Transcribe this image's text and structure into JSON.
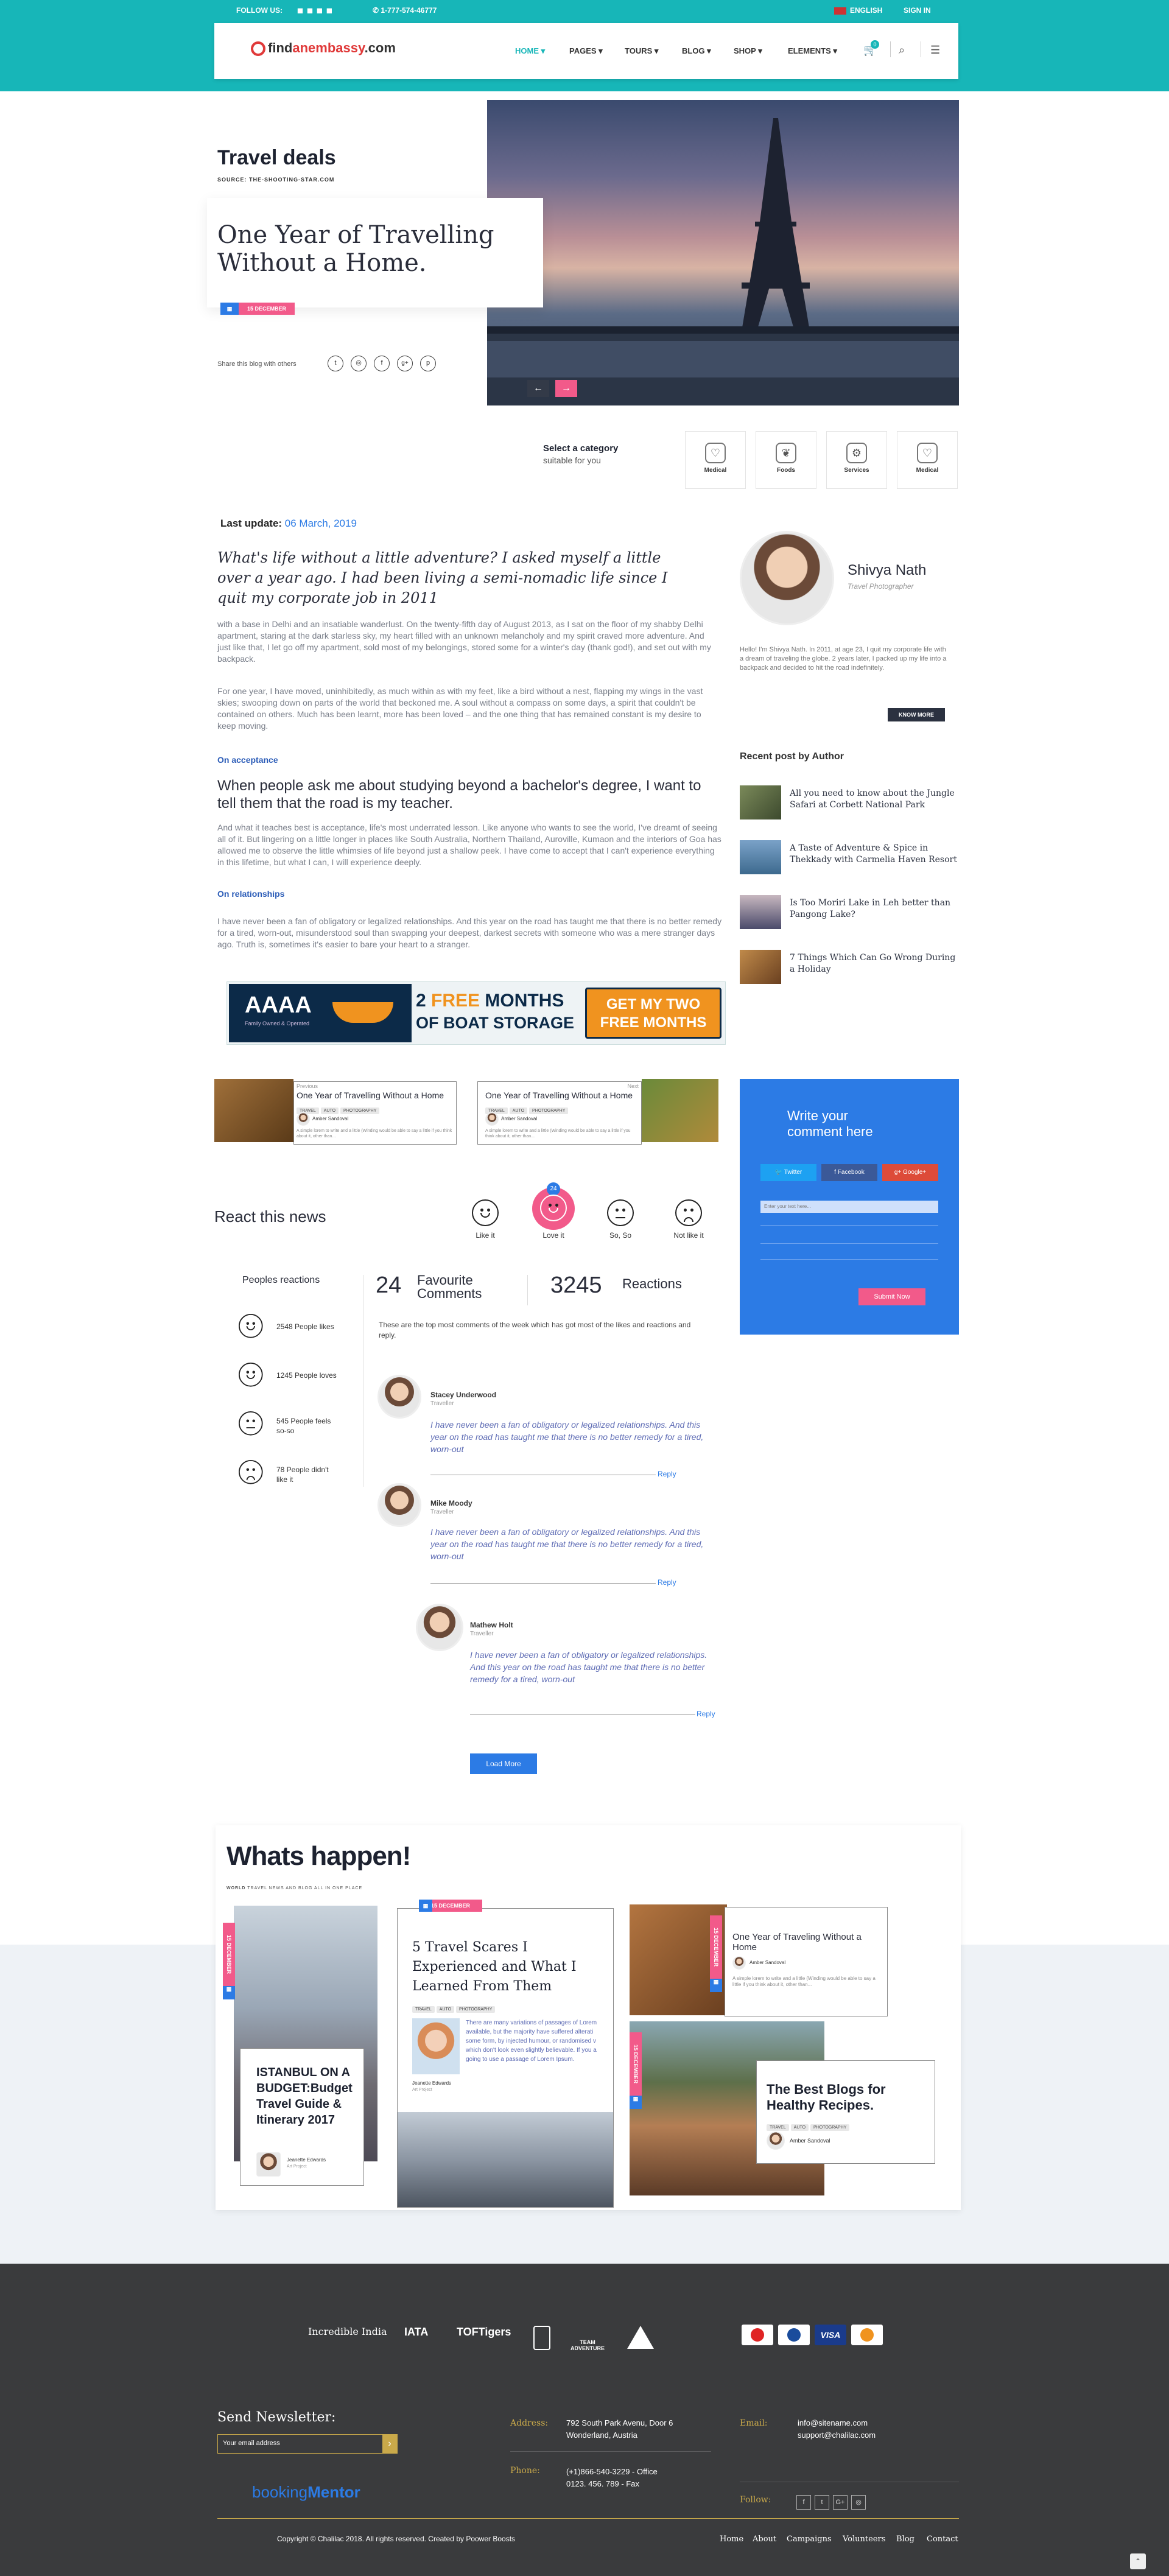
{
  "topbar": {
    "follow_us": "FOLLOW US:",
    "phone": "1-777-574-46777",
    "language": "ENGLISH",
    "sign_in": "SIGN IN"
  },
  "header": {
    "logo_pre": "find",
    "logo_em": "an",
    "logo_mid": "embassy",
    "logo_post": ".com",
    "nav": [
      "HOME",
      "PAGES",
      "TOURS",
      "BLOG",
      "SHOP",
      "ELEMENTS"
    ],
    "cart_count": "0"
  },
  "hero": {
    "category": "Travel deals",
    "source": "SOURCE: THE-SHOOTING-STAR.COM",
    "title_line1": "One Year of Travelling",
    "title_line2": "Without a Home.",
    "date_badge": "15 DECEMBER",
    "share_label": "Share this blog with others"
  },
  "categories": {
    "title": "Select a category",
    "subtitle": "suitable for you",
    "items": [
      "Medical",
      "Foods",
      "Services",
      "Medical"
    ]
  },
  "article": {
    "last_update_label": "Last update:",
    "last_update_value": "06 March, 2019",
    "lead": "What's life without a little adventure? I asked myself a little over a year ago. I had been living a semi-nomadic life since I quit my corporate job in 2011",
    "p1": "with a base in Delhi and an insatiable wanderlust. On the twenty-fifth day of August 2013, as I sat on the floor of my shabby Delhi apartment, staring at the dark starless sky, my heart filled with an unknown melancholy and my spirit craved more adventure. And just like that, I let go off my apartment, sold most of my belongings, stored some for a winter's day (thank god!), and set out with my backpack.",
    "p2": "For one year, I have moved, uninhibitedly, as much within as with my feet, like a bird without a nest, flapping my wings in the vast skies; swooping down on parts of the world that beckoned me. A soul without a compass on some days, a spirit that couldn't be contained on others. Much has been learnt, more has been loved – and the one thing that has remained constant is my desire to keep moving.",
    "h_acceptance": "On acceptance",
    "quote": "When people ask me about studying beyond a bachelor's degree, I want to tell them that the road is my teacher.",
    "p3": "And what it teaches best is acceptance, life's most underrated lesson. Like anyone who wants to see the world, I've dreamt of seeing all of it. But lingering on a little longer in places like South Australia, Northern Thailand, Auroville, Kumaon and the interiors of Goa has allowed me to observe the little whimsies of life beyond just a shallow peek. I have come to accept that I can't experience everything in this lifetime, but what I can, I will experience deeply.",
    "h_relationships": "On relationships",
    "p4": "I have never been a fan of obligatory or legalized relationships. And this year on the road has taught me that there is no better remedy for a tired, worn-out, misunderstood soul than swapping your deepest, darkest secrets with someone who was a mere stranger days ago. Truth is, sometimes it's easier to bare your heart to a stranger."
  },
  "ad": {
    "brand": "AAAA",
    "brand_sub": "Family Owned & Operated",
    "line1_pre": "2 ",
    "line1_em": "FREE",
    "line1_post": " MONTHS",
    "line2": "OF BOAT STORAGE",
    "cta": "GET MY TWO FREE MONTHS"
  },
  "author": {
    "name": "Shivya Nath",
    "role": "Travel Photographer",
    "bio": "Hello! I'm Shivya Nath. In 2011, at age 23, I quit my corporate life with a dream of traveling the globe. 2 years later, I packed up my life into a backpack and decided to hit the road indefinitely.",
    "know_more": "KNOW MORE"
  },
  "recent": {
    "title": "Recent post by Author",
    "items": [
      "All you need to know about the Jungle Safari at Corbett National Park",
      "A Taste of Adventure & Spice in Thekkady with Carmelia Haven Resort",
      "Is Too Moriri Lake in Leh better than Pangong Lake?",
      "7 Things Which Can Go Wrong During a Holiday"
    ]
  },
  "related": [
    {
      "tag": "Previous",
      "title": "One Year of Travelling Without a Home",
      "author": "Amber Sandoval",
      "text": "A simple lorem to write and a little (Winding would be able to say a little if you think about it, other than..."
    },
    {
      "tag": "Next",
      "title": "One Year of Travelling Without a Home",
      "author": "Amber Sandoval",
      "text": "A simple lorem to write and a little (Winding would be able to say a little if you think about it, other than..."
    }
  ],
  "related_tags": [
    "TRAVEL",
    "AUTO",
    "PHOTOGRAPHY"
  ],
  "comment_form": {
    "title_line1": "Write your",
    "title_line2": "comment here",
    "twitter": "Twitter",
    "facebook": "Facebook",
    "google": "Google+",
    "placeholder": "Enter your text here...",
    "submit": "Submit Now"
  },
  "react": {
    "title": "React this news",
    "badge": "24",
    "options": [
      "Like it",
      "Love it",
      "So, So",
      "Not like it"
    ]
  },
  "stats": {
    "reactions_title": "Peoples reactions",
    "fav_count": "24",
    "fav_label": "Favourite Comments",
    "reactions_count": "3245",
    "reactions_label": "Reactions",
    "intro": "These are the top most comments of the week which has got most of the likes and reactions and reply.",
    "rows": [
      "2548 People likes",
      "1245 People loves",
      "545 People feels so-so",
      "78 People didn't like it"
    ]
  },
  "comments": [
    {
      "name": "Stacey Underwood",
      "role": "Traveller",
      "text": "I have never been a fan of obligatory or legalized relationships. And this year on the road has taught me that there is no better remedy for a tired, worn-out",
      "reply": "Reply"
    },
    {
      "name": "Mike Moody",
      "role": "Traveller",
      "text": "I have never been a fan of obligatory or legalized relationships. And this year on the road has taught me that there is no better remedy for a tired, worn-out",
      "reply": "Reply"
    },
    {
      "name": "Mathew Holt",
      "role": "Traveller",
      "text": "I have never been a fan of obligatory or legalized relationships. And this year on the road has taught me that there is no better remedy for a tired, worn-out",
      "reply": "Reply"
    }
  ],
  "load_more": "Load More",
  "whats_happen": {
    "title": "Whats happen!",
    "sub_pre": "WORLD",
    "sub": "TRAVEL NEWS AND BLOG ALL IN ONE PLACE",
    "card1": {
      "date": "15 DECEMBER",
      "title": "ISTANBUL ON A BUDGET:Budget Travel Guide & Itinerary 2017",
      "author": "Jeanette Edwards",
      "role": "Art Project"
    },
    "card2": {
      "date": "15 DECEMBER",
      "title": "5 Travel Scares I Experienced and What I Learned From Them",
      "tags": [
        "TRAVEL",
        "AUTO",
        "PHOTOGRAPHY"
      ],
      "text": "There are many variations of passages of Lorem available, but the majority have suffered alterati some form, by injected humour, or randomised v which don't look even slightly believable. If you a going to use a passage of Lorem Ipsum.",
      "author": "Jeanette Edwards",
      "role": "Art Project"
    },
    "card3": {
      "date": "15 DECEMBER",
      "title": "One Year of Traveling Without a Home",
      "author": "Amber Sandoval",
      "text": "A simple lorem to write and a little (Winding would be able to say a little if you think about it, other than..."
    },
    "card4": {
      "date": "15 DECEMBER",
      "title": "The Best Blogs for Healthy Recipes.",
      "author": "Amber Sandoval"
    }
  },
  "footer": {
    "partners": [
      "Incredible India",
      "IATA",
      "TOFTigers",
      "",
      "TEAM ADVENTURE",
      ""
    ],
    "newsletter_title": "Send Newsletter:",
    "newsletter_placeholder": "Your email address",
    "address_label": "Address:",
    "address": "792 South Park Avenu, Door 6 Wonderland, Austria",
    "phone_label": "Phone:",
    "phone1": "(+1)866-540-3229 - Office",
    "phone2": "0123. 456. 789 - Fax",
    "email_label": "Email:",
    "email1": "info@sitename.com",
    "email2": "support@chalilac.com",
    "follow_label": "Follow:",
    "brand_pre": "booking",
    "brand_em": "Mentor",
    "copyright": "Copyright © Chalilac 2018. All rights reserved. Created by Poower Boosts",
    "links": [
      "Home",
      "About",
      "Campaigns",
      "Volunteers",
      "Blog",
      "Contact"
    ]
  },
  "colors": {
    "teal": "#17b6b8",
    "pink": "#f25a8a",
    "blue": "#2c7be5",
    "dark_footer": "#3a3b3d",
    "orange": "#f0931f"
  }
}
